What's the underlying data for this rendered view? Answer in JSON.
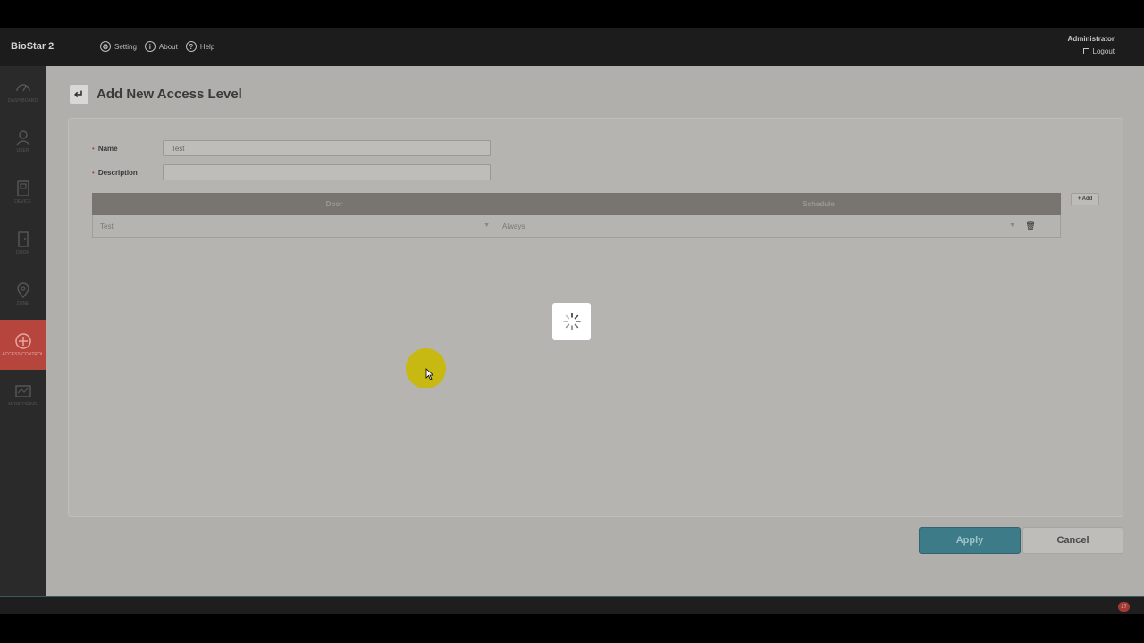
{
  "app": {
    "brand": "BioStar 2"
  },
  "topnav": [
    {
      "label": "Setting",
      "icon": "gear-icon"
    },
    {
      "label": "About",
      "icon": "info-icon"
    },
    {
      "label": "Help",
      "icon": "help-icon"
    }
  ],
  "user": {
    "name": "Administrator",
    "logout": "Logout"
  },
  "sidebar": {
    "items": [
      {
        "label": "DASH BOARD",
        "icon": "dashboard-icon"
      },
      {
        "label": "USER",
        "icon": "user-icon"
      },
      {
        "label": "DEVICE",
        "icon": "device-icon"
      },
      {
        "label": "DOOR",
        "icon": "door-icon"
      },
      {
        "label": "ZONE",
        "icon": "zone-icon"
      },
      {
        "label": "ACCESS CONTROL",
        "icon": "access-control-icon",
        "active": true
      },
      {
        "label": "MONITORING",
        "icon": "monitoring-icon"
      }
    ]
  },
  "page": {
    "title": "Add New Access Level"
  },
  "form": {
    "name_label": "Name",
    "name_value": "Test",
    "description_label": "Description",
    "description_value": ""
  },
  "table": {
    "headers": {
      "door": "Door",
      "schedule": "Schedule"
    },
    "rows": [
      {
        "door": "Test",
        "schedule": "Always"
      }
    ],
    "add_label": "+ Add"
  },
  "actions": {
    "apply": "Apply",
    "cancel": "Cancel"
  },
  "status": {
    "notification_count": "17"
  },
  "colors": {
    "accent": "#3d7b88",
    "active_nav": "#b5453d"
  }
}
